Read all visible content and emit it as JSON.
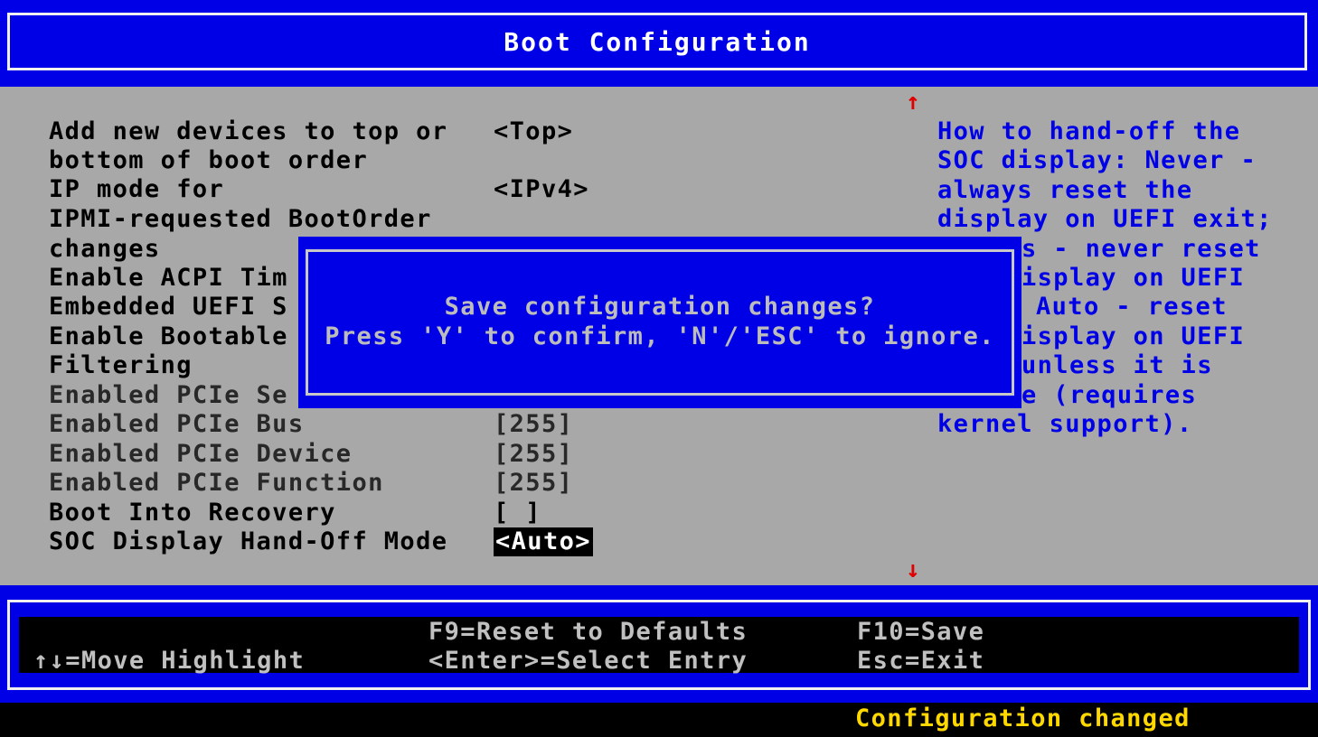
{
  "header": {
    "title": "Boot Configuration"
  },
  "settings": [
    {
      "label": "Add new devices to top or",
      "value": "<Top>"
    },
    {
      "label": "bottom of boot order",
      "value": ""
    },
    {
      "label": "IP mode for",
      "value": "<IPv4>"
    },
    {
      "label": "IPMI-requested BootOrder",
      "value": ""
    },
    {
      "label": "changes",
      "value": ""
    },
    {
      "label": "Enable ACPI Tim",
      "value": ""
    },
    {
      "label": "Embedded UEFI S",
      "value": ""
    },
    {
      "label": "Enable Bootable",
      "value": ""
    },
    {
      "label": "Filtering",
      "value": ""
    },
    {
      "label": "Enabled PCIe Se",
      "value": ""
    },
    {
      "label": "Enabled PCIe Bus",
      "value": "[255]"
    },
    {
      "label": "Enabled PCIe Device",
      "value": "[255]"
    },
    {
      "label": "Enabled PCIe Function",
      "value": "[255]"
    },
    {
      "label": "Boot Into Recovery",
      "value": "[ ]"
    },
    {
      "label": "SOC Display Hand-Off Mode",
      "value": "<Auto>"
    }
  ],
  "help_lines": [
    "How to hand-off the",
    "SOC display: Never -",
    "always reset the",
    "display on UEFI exit;",
    "s - never reset",
    "isplay on UEFI",
    "Auto - reset",
    "isplay on UEFI",
    "unless it is",
    "e (requires",
    "kernel support)."
  ],
  "scroll": {
    "up": "↑",
    "down": "↓"
  },
  "dialog": {
    "line1": "Save configuration changes?",
    "line2": "Press 'Y' to confirm, 'N'/'ESC' to ignore."
  },
  "footer": {
    "move": "↑↓=Move Highlight",
    "reset": "F9=Reset to Defaults",
    "select": "<Enter>=Select Entry",
    "save": "F10=Save",
    "exit": "Esc=Exit"
  },
  "status": {
    "text": "Configuration changed"
  },
  "colors": {
    "title_bg": "#0000e6",
    "body_bg": "#a8a8a8",
    "help_text": "#0000e6",
    "scroll_arrow": "#e00000",
    "status_text": "#ffd800"
  }
}
